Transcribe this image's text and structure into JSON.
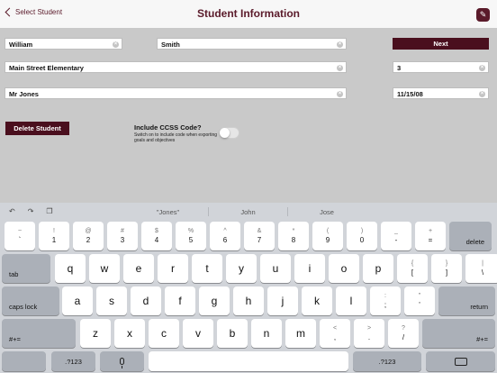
{
  "nav": {
    "back_label": "Select Student",
    "title": "Student Information",
    "app_icon_glyph": "✎"
  },
  "form": {
    "first_name": "William",
    "last_name": "Smith",
    "school": "Main Street Elementary",
    "grade": "3",
    "teacher": "Mr Jones",
    "date": "11/15/08",
    "next_label": "Next",
    "delete_label": "Delete Student",
    "ccss_label": "Include CCSS Code?",
    "ccss_desc": "Switch on to include code when exporting goals and objectives",
    "ccss_enabled": false
  },
  "colors": {
    "brand": "#4a0f1e",
    "nav_text": "#5a1a2a"
  },
  "keyboard": {
    "suggestions": [
      "\"Jones\"",
      "John",
      "Jose"
    ],
    "shortcut_icons": [
      "undo-icon",
      "redo-icon",
      "paste-icon"
    ],
    "row1": [
      {
        "top": "~",
        "bottom": "`"
      },
      {
        "top": "!",
        "bottom": "1"
      },
      {
        "top": "@",
        "bottom": "2"
      },
      {
        "top": "#",
        "bottom": "3"
      },
      {
        "top": "$",
        "bottom": "4"
      },
      {
        "top": "%",
        "bottom": "5"
      },
      {
        "top": "^",
        "bottom": "6"
      },
      {
        "top": "&",
        "bottom": "7"
      },
      {
        "top": "*",
        "bottom": "8"
      },
      {
        "top": "(",
        "bottom": "9"
      },
      {
        "top": ")",
        "bottom": "0"
      },
      {
        "top": "_",
        "bottom": "-"
      },
      {
        "top": "+",
        "bottom": "="
      }
    ],
    "delete": "delete",
    "tab": "tab",
    "row2": [
      "q",
      "w",
      "e",
      "r",
      "t",
      "y",
      "u",
      "i",
      "o",
      "p"
    ],
    "row2_extra": [
      {
        "top": "{",
        "bottom": "["
      },
      {
        "top": "}",
        "bottom": "]"
      },
      {
        "top": "|",
        "bottom": "\\"
      }
    ],
    "caps": "caps lock",
    "row3": [
      "a",
      "s",
      "d",
      "f",
      "g",
      "h",
      "j",
      "k",
      "l"
    ],
    "row3_extra": [
      {
        "top": ":",
        "bottom": ";"
      },
      {
        "top": "\"",
        "bottom": "'"
      }
    ],
    "return": "return",
    "shift_left": "#+=",
    "row4": [
      "z",
      "x",
      "c",
      "v",
      "b",
      "n",
      "m"
    ],
    "row4_extra": [
      {
        "top": "<",
        "bottom": ","
      },
      {
        "top": ">",
        "bottom": "."
      },
      {
        "top": "?",
        "bottom": "/"
      }
    ],
    "shift_right": "#+=",
    "num_left": ".?123",
    "num_right": ".?123"
  }
}
